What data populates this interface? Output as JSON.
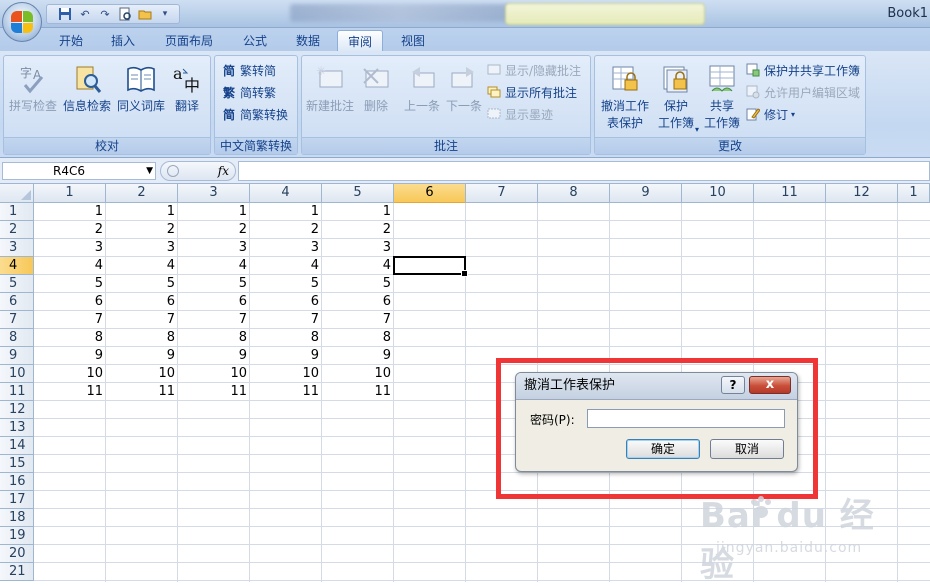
{
  "window": {
    "book_title": "Book1"
  },
  "tabs": [
    {
      "label": "开始"
    },
    {
      "label": "插入"
    },
    {
      "label": "页面布局"
    },
    {
      "label": "公式"
    },
    {
      "label": "数据"
    },
    {
      "label": "审阅",
      "active": true
    },
    {
      "label": "视图"
    }
  ],
  "ribbon": {
    "proofing": {
      "group_label": "校对",
      "spelling": "拼写检查",
      "research": "信息检索",
      "thesaurus": "同义词库",
      "translate": "翻译"
    },
    "chinese_conversion": {
      "group_label": "中文简繁转换",
      "to_simplified": "繁转简",
      "to_traditional": "简转繁",
      "convert": "简繁转换"
    },
    "comments": {
      "group_label": "批注",
      "new_comment": "新建批注",
      "delete": "删除",
      "previous": "上一条",
      "next": "下一条",
      "show_hide": "显示/隐藏批注",
      "show_all": "显示所有批注",
      "show_ink": "显示墨迹"
    },
    "changes": {
      "group_label": "更改",
      "unprotect_sheet": [
        "撤消工作",
        "表保护"
      ],
      "protect_workbook": [
        "保护",
        "工作簿"
      ],
      "share_workbook": [
        "共享",
        "工作簿"
      ],
      "protect_and_share": "保护并共享工作簿",
      "allow_edit_ranges": "允许用户编辑区域",
      "track_changes": "修订"
    }
  },
  "formula_bar": {
    "name_box": "R4C6",
    "fx": "fx",
    "value": ""
  },
  "grid": {
    "columns": [
      "1",
      "2",
      "3",
      "4",
      "5",
      "6",
      "7",
      "8",
      "9",
      "10",
      "11",
      "12",
      "1"
    ],
    "rows": [
      "1",
      "2",
      "3",
      "4",
      "5",
      "6",
      "7",
      "8",
      "9",
      "10",
      "11",
      "12",
      "13",
      "14",
      "15",
      "16",
      "17",
      "18",
      "19",
      "20",
      "21"
    ],
    "selected_col": 6,
    "selected_row": 4,
    "data": [
      [
        "1",
        "1",
        "1",
        "1",
        "1"
      ],
      [
        "2",
        "2",
        "2",
        "2",
        "2"
      ],
      [
        "3",
        "3",
        "3",
        "3",
        "3"
      ],
      [
        "4",
        "4",
        "4",
        "4",
        "4"
      ],
      [
        "5",
        "5",
        "5",
        "5",
        "5"
      ],
      [
        "6",
        "6",
        "6",
        "6",
        "6"
      ],
      [
        "7",
        "7",
        "7",
        "7",
        "7"
      ],
      [
        "8",
        "8",
        "8",
        "8",
        "8"
      ],
      [
        "9",
        "9",
        "9",
        "9",
        "9"
      ],
      [
        "10",
        "10",
        "10",
        "10",
        "10"
      ],
      [
        "11",
        "11",
        "11",
        "11",
        "11"
      ]
    ]
  },
  "dialog": {
    "title": "撤消工作表保护",
    "help": "?",
    "close": "x",
    "password_label": "密码(P):",
    "password_value": "",
    "ok": "确定",
    "cancel": "取消"
  },
  "watermark": {
    "brand": "Bai du 经验",
    "url": "jingyan.baidu.com"
  },
  "colors": {
    "highlight_frame": "#ef3535",
    "selected_header": "#f8c857",
    "ribbon_text": "#15428b"
  }
}
